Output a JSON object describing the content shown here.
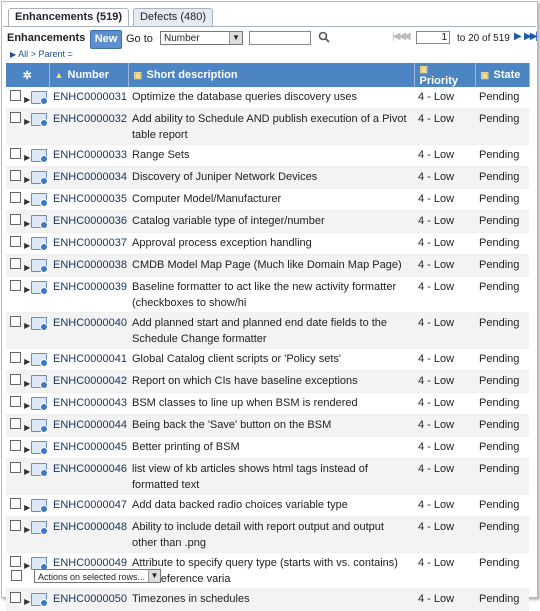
{
  "tabs": [
    {
      "label": "Enhancements (519)"
    },
    {
      "label": "Defects (480)"
    }
  ],
  "toolbar": {
    "title": "Enhancements",
    "new_label": "New",
    "goto_label": "Go to",
    "goto_field": "Number",
    "search_value": ""
  },
  "pager": {
    "current": "1",
    "range_text": "to 20 of 519"
  },
  "breadcrumb": {
    "all": "All",
    "sep": ">",
    "parent": "Parent ="
  },
  "columns": {
    "number": "Number",
    "short_description": "Short description",
    "priority": "Priority",
    "state": "State"
  },
  "rows": [
    {
      "number": "ENHC0000031",
      "desc": "Optimize the database queries discovery uses",
      "priority": "4 - Low",
      "state": "Pending"
    },
    {
      "number": "ENHC0000032",
      "desc": "Add ability to Schedule AND publish execution of a Pivot table report",
      "priority": "4 - Low",
      "state": "Pending"
    },
    {
      "number": "ENHC0000033",
      "desc": "Range Sets",
      "priority": "4 - Low",
      "state": "Pending"
    },
    {
      "number": "ENHC0000034",
      "desc": "Discovery of Juniper Network Devices",
      "priority": "4 - Low",
      "state": "Pending"
    },
    {
      "number": "ENHC0000035",
      "desc": "Computer Model/Manufacturer",
      "priority": "4 - Low",
      "state": "Pending"
    },
    {
      "number": "ENHC0000036",
      "desc": "Catalog variable type of integer/number",
      "priority": "4 - Low",
      "state": "Pending"
    },
    {
      "number": "ENHC0000037",
      "desc": "Approval process exception handling",
      "priority": "4 - Low",
      "state": "Pending"
    },
    {
      "number": "ENHC0000038",
      "desc": "CMDB Model Map Page (Much like Domain Map Page)",
      "priority": "4 - Low",
      "state": "Pending"
    },
    {
      "number": "ENHC0000039",
      "desc": "Baseline formatter to act like the new activity formatter (checkboxes to show/hi",
      "priority": "4 - Low",
      "state": "Pending"
    },
    {
      "number": "ENHC0000040",
      "desc": "Add planned start and planned end date fields to the Schedule Change formatter",
      "priority": "4 - Low",
      "state": "Pending"
    },
    {
      "number": "ENHC0000041",
      "desc": "Global Catalog client scripts or 'Policy sets'",
      "priority": "4 - Low",
      "state": "Pending"
    },
    {
      "number": "ENHC0000042",
      "desc": "Report on which CIs have baseline exceptions",
      "priority": "4 - Low",
      "state": "Pending"
    },
    {
      "number": "ENHC0000043",
      "desc": "BSM classes to line up when BSM is rendered",
      "priority": "4 - Low",
      "state": "Pending"
    },
    {
      "number": "ENHC0000044",
      "desc": "Being back the 'Save' button on the BSM",
      "priority": "4 - Low",
      "state": "Pending"
    },
    {
      "number": "ENHC0000045",
      "desc": "Better printing of BSM",
      "priority": "4 - Low",
      "state": "Pending"
    },
    {
      "number": "ENHC0000046",
      "desc": "list view of kb articles shows html tags instead of formatted text",
      "priority": "4 - Low",
      "state": "Pending"
    },
    {
      "number": "ENHC0000047",
      "desc": "Add data backed radio choices variable type",
      "priority": "4 - Low",
      "state": "Pending"
    },
    {
      "number": "ENHC0000048",
      "desc": "Ability to include detail with report output and output other than .png",
      "priority": "4 - Low",
      "state": "Pending"
    },
    {
      "number": "ENHC0000049",
      "desc": "Attribute to specify query type (starts with vs. contains) for a reference varia",
      "priority": "4 - Low",
      "state": "Pending"
    },
    {
      "number": "ENHC0000050",
      "desc": "Timezones in schedules",
      "priority": "4 - Low",
      "state": "Pending"
    }
  ],
  "footer": {
    "actions_label": "Actions on selected rows..."
  },
  "colors": {
    "header_bg": "#4d84c4",
    "new_button": "#5b8fd0"
  }
}
